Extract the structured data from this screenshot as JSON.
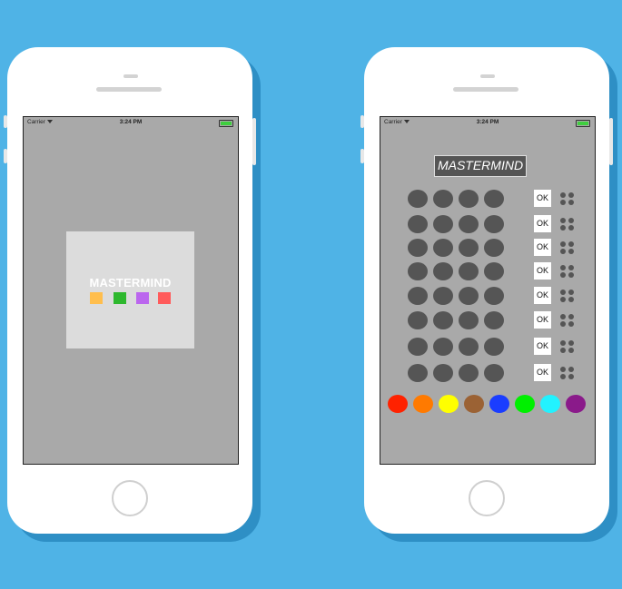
{
  "status_bar": {
    "carrier": "Carrier",
    "time": "3:24 PM"
  },
  "splash": {
    "title": "MASTERMIND",
    "swatches": [
      {
        "name": "orange",
        "color": "#ffbe4d"
      },
      {
        "name": "green",
        "color": "#2eb82e"
      },
      {
        "name": "purple",
        "color": "#bb66ee"
      },
      {
        "name": "red",
        "color": "#ff5b5b"
      }
    ]
  },
  "game": {
    "title": "MASTERMIND",
    "guess_rows": 8,
    "pegs_per_row": 4,
    "ok_label": "OK",
    "empty_peg_color": "#555555",
    "palette": [
      {
        "name": "red",
        "color": "#ff2200"
      },
      {
        "name": "orange",
        "color": "#ff7a00"
      },
      {
        "name": "yellow",
        "color": "#ffff00"
      },
      {
        "name": "brown",
        "color": "#9b6234"
      },
      {
        "name": "blue",
        "color": "#1a3dff"
      },
      {
        "name": "green",
        "color": "#00f000"
      },
      {
        "name": "cyan",
        "color": "#22f2ff"
      },
      {
        "name": "purple",
        "color": "#8a1a8a"
      }
    ]
  }
}
